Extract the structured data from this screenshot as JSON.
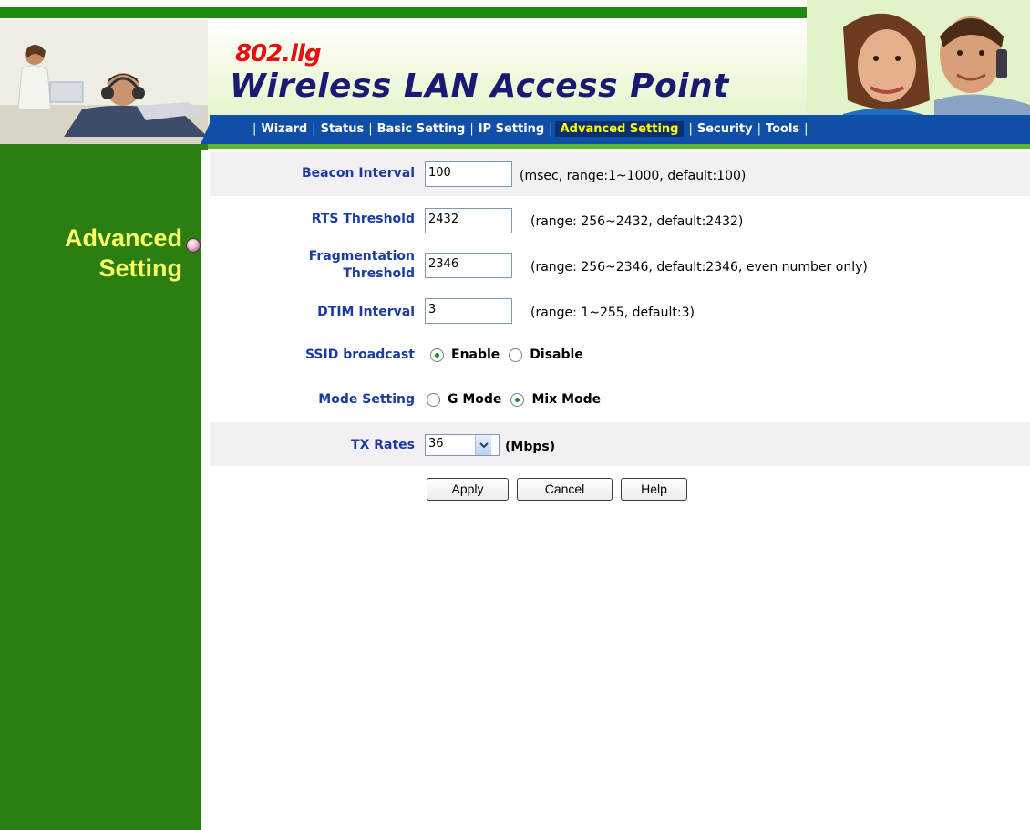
{
  "header": {
    "title_small": "802.llg",
    "title_main": "Wireless LAN Access Point"
  },
  "nav": {
    "items": [
      "Wizard",
      "Status",
      "Basic Setting",
      "IP Setting",
      "Advanced Setting",
      "Security",
      "Tools"
    ],
    "active": "Advanced Setting"
  },
  "sidebar": {
    "title_line1": "Advanced",
    "title_line2": "Setting"
  },
  "form": {
    "beacon_interval": {
      "label": "Beacon Interval",
      "value": "100",
      "hint": "(msec, range:1~1000, default:100)"
    },
    "rts_threshold": {
      "label": "RTS Threshold",
      "value": "2432",
      "hint": "(range: 256~2432, default:2432)"
    },
    "fragmentation_threshold": {
      "label_line1": "Fragmentation",
      "label_line2": "Threshold",
      "value": "2346",
      "hint": "(range: 256~2346, default:2346, even number only)"
    },
    "dtim_interval": {
      "label": "DTIM Interval",
      "value": "3",
      "hint": "(range: 1~255, default:3)"
    },
    "ssid_broadcast": {
      "label": "SSID broadcast",
      "options": [
        "Enable",
        "Disable"
      ],
      "selected": "Enable"
    },
    "mode_setting": {
      "label": "Mode Setting",
      "options": [
        "G Mode",
        "Mix Mode"
      ],
      "selected": "Mix Mode"
    },
    "tx_rates": {
      "label": "TX Rates",
      "value": "36",
      "unit": "(Mbps)"
    }
  },
  "buttons": {
    "apply": "Apply",
    "cancel": "Cancel",
    "help": "Help"
  },
  "colors": {
    "sidebar_green": "#2a7f10",
    "nav_blue": "#0f4fa8",
    "label_blue": "#1c3aa0",
    "active_nav_text": "#ffff00",
    "sidebar_title": "#ffff66"
  }
}
